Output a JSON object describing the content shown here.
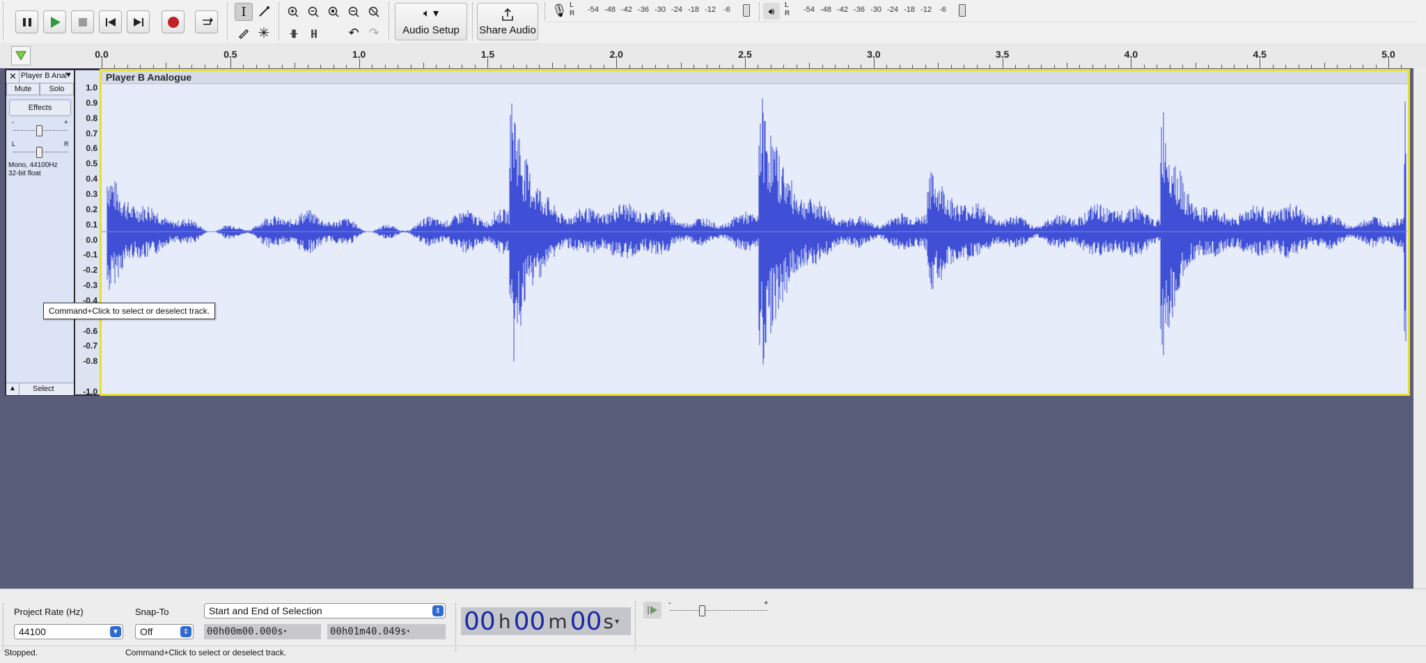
{
  "toolbar": {
    "audio_setup_label": "Audio Setup",
    "share_audio_label": "Share Audio",
    "record_meter_ticks": [
      "-54",
      "-48",
      "-42",
      "-36",
      "-30",
      "-24",
      "-18",
      "-12",
      "-6"
    ],
    "play_meter_ticks": [
      "-54",
      "-48",
      "-42",
      "-36",
      "-30",
      "-24",
      "-18",
      "-12",
      "-6"
    ],
    "meter_channel_l": "L",
    "meter_channel_r": "R"
  },
  "ruler": {
    "ticks": [
      "0.0",
      "0.5",
      "1.0",
      "1.5",
      "2.0",
      "2.5",
      "3.0",
      "3.5",
      "4.0",
      "4.5",
      "5.0"
    ]
  },
  "track": {
    "name": "Player B Analogue",
    "name_short": "Player B Anal",
    "mute_label": "Mute",
    "solo_label": "Solo",
    "effects_label": "Effects",
    "info_line1": "Mono, 44100Hz",
    "info_line2": "32-bit float",
    "select_label": "Select",
    "gain_minus": "-",
    "gain_plus": "+",
    "pan_left": "L",
    "pan_right": "R",
    "amp_labels": [
      "1.0",
      "0.9",
      "0.8",
      "0.7",
      "0.6",
      "0.5",
      "0.4",
      "0.3",
      "0.2",
      "0.1",
      "0.0",
      "-0.1",
      "-0.2",
      "-0.3",
      "-0.4",
      "-0.5",
      "-0.6",
      "-0.7",
      "-0.8",
      "-1.0"
    ],
    "wave_color": "#3f4fd6"
  },
  "tooltip": "Command+Click to select or deselect track.",
  "bottom": {
    "project_rate_label": "Project Rate (Hz)",
    "project_rate_value": "44100",
    "snap_to_label": "Snap-To",
    "snap_to_value": "Off",
    "selection_mode": "Start and End of Selection",
    "selection_start": "00h00m00.000s",
    "selection_end": "00h01m40.049s",
    "big_time": {
      "h": "00",
      "m": "00",
      "s": "00"
    },
    "speed_minus": "-",
    "speed_plus": "+"
  },
  "status": {
    "state": "Stopped.",
    "message": "Command+Click to select or deselect track."
  }
}
